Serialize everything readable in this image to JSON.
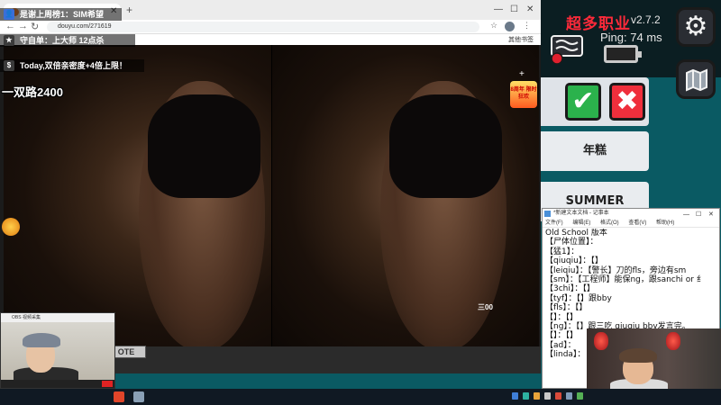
{
  "browser": {
    "tab_title": "",
    "url": "douyu.com/271619",
    "bookmarks_label": "其他书签",
    "stream": {
      "overlay_row1": "是谢上周榜1：SIM希望",
      "overlay_row2": "守自单：上大师 12点杀",
      "overlay_row3": "Today,双倍亲密度+4倍上限！",
      "overlay_big": "一双路2400",
      "gift_badge_text": "8周年 限时狂欢",
      "video_caption": "三00",
      "brand_chip": "OTE",
      "plus_label": "+"
    }
  },
  "game": {
    "title": "超多职业",
    "version": "v2.7.2",
    "ping": "Ping: 74 ms",
    "word_cards": [
      "年糕",
      "SUMMER"
    ],
    "colors": {
      "accent_red": "#ff2a3a",
      "confirm_green": "#2bb24c",
      "reject_red": "#ef2f3c",
      "panel_teal": "#0a5a63"
    }
  },
  "notepad": {
    "title": "*新建文本文档 - 记事本",
    "menu": [
      "文件(F)",
      "编辑(E)",
      "格式(O)",
      "查看(V)",
      "帮助(H)"
    ],
    "lines": [
      "Old School 版本",
      "【尸体位置】：",
      "【猛1】：",
      "【qiuqiu】：【】",
      "【leiqiu】：【警长】刀的fls，旁边有sm",
      "【sm】：【工程师】能保ng，跟sanchi or 纟",
      "【3chi】：【】",
      "【tyf】：【】跟bby",
      "【fls】：【】",
      "【】：【】",
      "【ng】：【】跟三吃 qiuqiu bby发言完。",
      "【】：【】",
      "【ad】：",
      "【linda】："
    ]
  },
  "webcam1": {
    "title": "OBS 视频采集",
    "icon": "camera-icon"
  },
  "taskbar": {
    "time": "",
    "date": ""
  }
}
